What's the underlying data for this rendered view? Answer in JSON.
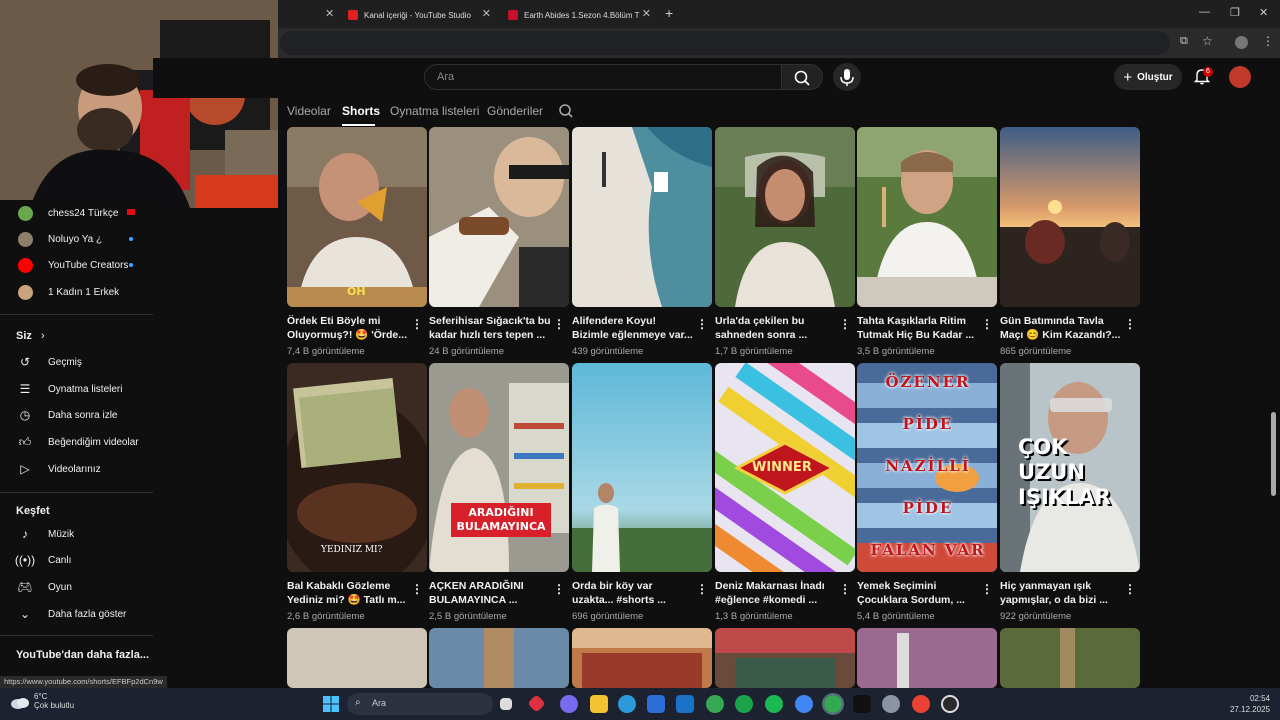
{
  "browser": {
    "tabs": [
      {
        "label": "Kanal içeriği - YouTube Studio"
      },
      {
        "label": "Earth Abides 1.Sezon 4.Bölüm T"
      }
    ],
    "new_tab": "+"
  },
  "search": {
    "placeholder": "Ara"
  },
  "header": {
    "create_label": "Oluştur",
    "notif_count": "6"
  },
  "channel_tabs": [
    {
      "label": "Videolar"
    },
    {
      "label": "Shorts"
    },
    {
      "label": "Oynatma listeleri"
    },
    {
      "label": "Gönderiler"
    }
  ],
  "sidebar": {
    "subscriptions": [
      {
        "label": "chess24 Türkçe"
      },
      {
        "label": "Noluyo Ya ¿"
      },
      {
        "label": "YouTube Creators"
      },
      {
        "label": "1 Kadın 1 Erkek"
      }
    ],
    "you_heading": "Siz",
    "you_items": [
      {
        "label": "Geçmiş"
      },
      {
        "label": "Oynatma listeleri"
      },
      {
        "label": "Daha sonra izle"
      },
      {
        "label": "Beğendiğim videolar"
      },
      {
        "label": "Videolarınız"
      }
    ],
    "explore_heading": "Keşfet",
    "explore_items": [
      {
        "label": "Müzik"
      },
      {
        "label": "Canlı"
      },
      {
        "label": "Oyun"
      },
      {
        "label": "Daha fazla göster"
      }
    ],
    "more_heading": "YouTube'dan daha fazla..."
  },
  "shorts": [
    {
      "title": "Ördek Eti Böyle mi Oluyormuş?! 🤩 'Örde...",
      "views": "7,4 B görüntüleme",
      "overlay": "OH"
    },
    {
      "title": "Seferihisar Sığacık'ta bu kadar hızlı ters tepen ...",
      "views": "24 B görüntüleme",
      "overlay": ""
    },
    {
      "title": "Alifendere Koyu! Bizimle eğlenmeye var...",
      "views": "439 görüntüleme",
      "overlay": ""
    },
    {
      "title": "Urla'da çekilen bu sahneden sonra ...",
      "views": "1,7 B görüntüleme",
      "overlay": ""
    },
    {
      "title": "Tahta Kaşıklarla Ritim Tutmak Hiç Bu Kadar ...",
      "views": "3,5 B görüntüleme",
      "overlay": ""
    },
    {
      "title": "Gün Batımında Tavla Maçı 😊 Kim Kazandı?...",
      "views": "865 görüntüleme",
      "overlay": ""
    },
    {
      "title": "Bal Kabaklı Gözleme Yediniz mi? 🤩 Tatlı m...",
      "views": "2,6 B görüntüleme",
      "overlay": "YEDINIZ MI?"
    },
    {
      "title": "AÇKEN ARADIĞINI BULAMAYINCA ...",
      "views": "2,5 B görüntüleme",
      "overlay": "ARADIĞINI BULAMAYINCA"
    },
    {
      "title": "Orda bir köy var uzakta... #shorts ...",
      "views": "696 görüntüleme",
      "overlay": ""
    },
    {
      "title": "Deniz Makarnası İnadı #eğlence #komedi ...",
      "views": "1,3 B görüntüleme",
      "overlay": "WINNER"
    },
    {
      "title": "Yemek Seçimini Çocuklara Sordum, ...",
      "views": "5,4 B görüntüleme",
      "overlay": "ÖZENER PİDE NAZİLLİ PİDE FALAN VAR"
    },
    {
      "title": "Hiç yanmayan ışık yapmışlar, o da bizi ...",
      "views": "922 görüntüleme",
      "overlay": "ÇOK UZUN IŞIKLAR"
    }
  ],
  "status_url": "https://www.youtube.com/shorts/EFBFp2dCn9w",
  "taskbar": {
    "weather_temp": "6°C",
    "weather_desc": "Çok bulutlu",
    "search_placeholder": "Ara",
    "time": "02:54",
    "date": "27.12.2025"
  }
}
